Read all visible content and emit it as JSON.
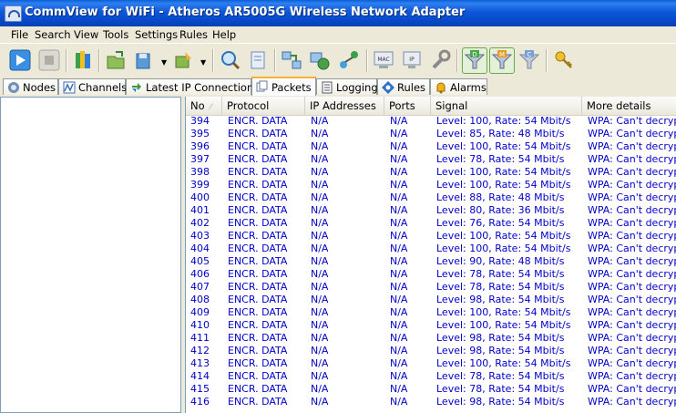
{
  "window": {
    "title": "CommView for WiFi - Atheros AR5005G Wireless Network Adapter"
  },
  "menu": [
    "File",
    "Search",
    "View",
    "Tools",
    "Settings",
    "Rules",
    "Help"
  ],
  "toolbar": {
    "buttons": [
      "start-capture-icon",
      "stop-capture-icon",
      "open-icon",
      "save-icon",
      "export-icon",
      "edit-icon",
      "search-icon",
      "log-icon",
      "reconstruct-icon",
      "refresh-icon",
      "node-icon",
      "mac-alias-icon",
      "ip-alias-icon",
      "tools-icon",
      "data-filter-icon",
      "management-filter-icon",
      "control-filter-icon",
      "keys-icon"
    ],
    "mac_label": "MAC",
    "ip_label": "IP",
    "filter_d": "D",
    "filter_m": "M",
    "filter_c": "C"
  },
  "tabs": [
    {
      "label": "Nodes",
      "icon": "nodes-icon"
    },
    {
      "label": "Channels",
      "icon": "channels-icon"
    },
    {
      "label": "Latest IP Connections",
      "icon": "ip-connections-icon"
    },
    {
      "label": "Packets",
      "icon": "packets-icon",
      "active": true
    },
    {
      "label": "Logging",
      "icon": "logging-icon"
    },
    {
      "label": "Rules",
      "icon": "rules-icon"
    },
    {
      "label": "Alarms",
      "icon": "alarms-icon"
    }
  ],
  "packets": {
    "columns": [
      "No",
      "Protocol",
      "IP Addresses",
      "Ports",
      "Signal",
      "More details"
    ],
    "sort_indicator": "⁄",
    "rows": [
      [
        "394",
        "ENCR. DATA",
        "N/A",
        "N/A",
        "Level: 100, Rate: 54 Mbit/s",
        "WPA: Can't decrypt"
      ],
      [
        "395",
        "ENCR. DATA",
        "N/A",
        "N/A",
        "Level: 85, Rate: 48 Mbit/s",
        "WPA: Can't decrypt"
      ],
      [
        "396",
        "ENCR. DATA",
        "N/A",
        "N/A",
        "Level: 100, Rate: 54 Mbit/s",
        "WPA: Can't decrypt"
      ],
      [
        "397",
        "ENCR. DATA",
        "N/A",
        "N/A",
        "Level: 78, Rate: 54 Mbit/s",
        "WPA: Can't decrypt"
      ],
      [
        "398",
        "ENCR. DATA",
        "N/A",
        "N/A",
        "Level: 100, Rate: 54 Mbit/s",
        "WPA: Can't decrypt"
      ],
      [
        "399",
        "ENCR. DATA",
        "N/A",
        "N/A",
        "Level: 100, Rate: 54 Mbit/s",
        "WPA: Can't decrypt"
      ],
      [
        "400",
        "ENCR. DATA",
        "N/A",
        "N/A",
        "Level: 88, Rate: 48 Mbit/s",
        "WPA: Can't decrypt"
      ],
      [
        "401",
        "ENCR. DATA",
        "N/A",
        "N/A",
        "Level: 80, Rate: 36 Mbit/s",
        "WPA: Can't decrypt"
      ],
      [
        "402",
        "ENCR. DATA",
        "N/A",
        "N/A",
        "Level: 76, Rate: 54 Mbit/s",
        "WPA: Can't decrypt"
      ],
      [
        "403",
        "ENCR. DATA",
        "N/A",
        "N/A",
        "Level: 100, Rate: 54 Mbit/s",
        "WPA: Can't decrypt"
      ],
      [
        "404",
        "ENCR. DATA",
        "N/A",
        "N/A",
        "Level: 100, Rate: 54 Mbit/s",
        "WPA: Can't decrypt"
      ],
      [
        "405",
        "ENCR. DATA",
        "N/A",
        "N/A",
        "Level: 90, Rate: 48 Mbit/s",
        "WPA: Can't decrypt"
      ],
      [
        "406",
        "ENCR. DATA",
        "N/A",
        "N/A",
        "Level: 78, Rate: 54 Mbit/s",
        "WPA: Can't decrypt"
      ],
      [
        "407",
        "ENCR. DATA",
        "N/A",
        "N/A",
        "Level: 78, Rate: 54 Mbit/s",
        "WPA: Can't decrypt"
      ],
      [
        "408",
        "ENCR. DATA",
        "N/A",
        "N/A",
        "Level: 98, Rate: 54 Mbit/s",
        "WPA: Can't decrypt"
      ],
      [
        "409",
        "ENCR. DATA",
        "N/A",
        "N/A",
        "Level: 100, Rate: 54 Mbit/s",
        "WPA: Can't decrypt"
      ],
      [
        "410",
        "ENCR. DATA",
        "N/A",
        "N/A",
        "Level: 100, Rate: 54 Mbit/s",
        "WPA: Can't decrypt"
      ],
      [
        "411",
        "ENCR. DATA",
        "N/A",
        "N/A",
        "Level: 98, Rate: 54 Mbit/s",
        "WPA: Can't decrypt"
      ],
      [
        "412",
        "ENCR. DATA",
        "N/A",
        "N/A",
        "Level: 98, Rate: 54 Mbit/s",
        "WPA: Can't decrypt"
      ],
      [
        "413",
        "ENCR. DATA",
        "N/A",
        "N/A",
        "Level: 100, Rate: 54 Mbit/s",
        "WPA: Can't decrypt"
      ],
      [
        "414",
        "ENCR. DATA",
        "N/A",
        "N/A",
        "Level: 78, Rate: 54 Mbit/s",
        "WPA: Can't decrypt"
      ],
      [
        "415",
        "ENCR. DATA",
        "N/A",
        "N/A",
        "Level: 78, Rate: 54 Mbit/s",
        "WPA: Can't decrypt"
      ],
      [
        "416",
        "ENCR. DATA",
        "N/A",
        "N/A",
        "Level: 98, Rate: 54 Mbit/s",
        "WPA: Can't decrypt"
      ]
    ]
  },
  "colors": {
    "packet_text": "#0000c8",
    "title_bar": "#0a4fd0",
    "active_tab_accent": "#f9b031"
  }
}
